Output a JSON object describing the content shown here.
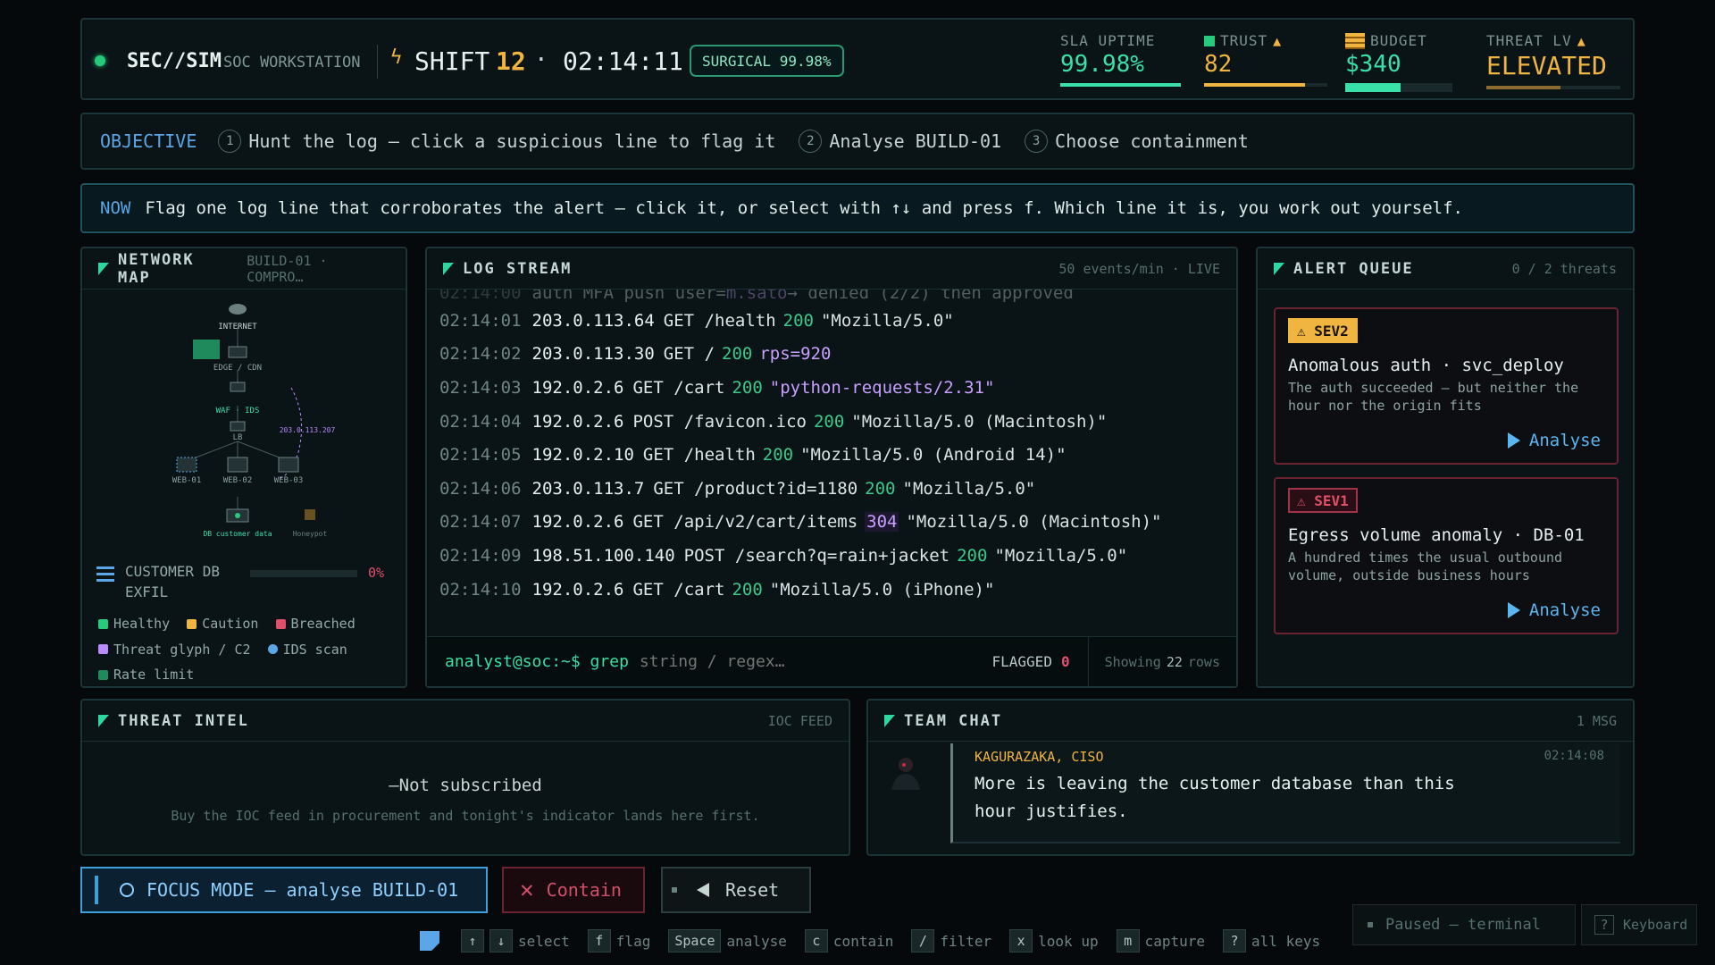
{
  "topbar": {
    "brand": "SEC//SIM",
    "brand_sub": "SOC WORKSTATION",
    "shift_icon": "lightning-icon",
    "shift_label": "SHIFT",
    "shift_num": "12",
    "clock": "02:14:11",
    "surgical": "SURGICAL 99.98%",
    "sla": {
      "label": "SLA UPTIME",
      "value": "99.98%",
      "level": 0.998
    },
    "trust": {
      "label": "TRUST",
      "value": "82",
      "level": 0.82
    },
    "budget": {
      "label": "BUDGET",
      "value": "$340",
      "level": 0.52
    },
    "threat": {
      "label": "THREAT LV",
      "value": "ELEVATED",
      "level": 0.55
    }
  },
  "objective": {
    "label": "OBJECTIVE",
    "steps": [
      {
        "num": "1",
        "text": "Hunt the log — click a suspicious line to flag it"
      },
      {
        "num": "2",
        "text": "Analyse BUILD-01"
      },
      {
        "num": "3",
        "text": "Choose containment"
      }
    ]
  },
  "now": {
    "label": "NOW",
    "text": "Flag one log line that corroborates the alert — click it, or select with ↑↓ and press f. Which line it is, you work out yourself."
  },
  "netmap": {
    "title": "NETWORK MAP",
    "sub": "BUILD-01 · COMPRO…",
    "nodes": {
      "internet": "INTERNET",
      "edge": "EDGE / CDN",
      "waf": "WAF · IDS",
      "lb": "LB",
      "web1": "WEB-01",
      "web2": "WEB-02",
      "web3": "WEB-03",
      "db": "DB customer data",
      "honeypot": "Honeypot",
      "threat_ip": "203.0.113.207"
    },
    "customer_db": {
      "label": "CUSTOMER DB EXFIL",
      "pct": "0%"
    },
    "legend": [
      {
        "label": "Healthy",
        "color": "#27c97d"
      },
      {
        "label": "Caution",
        "color": "#f0b440"
      },
      {
        "label": "Breached",
        "color": "#e0506a"
      },
      {
        "label": "Threat glyph / C2",
        "color": "#b88cff"
      },
      {
        "label": "IDS scan",
        "color": "#5aa6e6"
      },
      {
        "label": "Rate limit",
        "color": "#27c97d"
      }
    ]
  },
  "logstream": {
    "title": "LOG STREAM",
    "right": "50 events/min · LIVE",
    "faded": {
      "ts": "02:14:00",
      "pre": "auth MFA push user=",
      "user": "m.sato",
      "post": " → denied (2/2) then approved"
    },
    "lines": [
      {
        "ts": "02:14:01",
        "ip": "203.0.113.64",
        "method": "GET",
        "path": "/health",
        "status": "200",
        "ua": "\"Mozilla/5.0\""
      },
      {
        "ts": "02:14:02",
        "ip": "203.0.113.30",
        "method": "GET",
        "path": "/",
        "status": "200",
        "extra": "rps=920"
      },
      {
        "ts": "02:14:03",
        "ip": "192.0.2.6",
        "method": "GET",
        "path": "/cart",
        "status": "200",
        "ua_sus": "\"python-requests/2.31\""
      },
      {
        "ts": "02:14:04",
        "ip": "192.0.2.6",
        "method": "POST",
        "path": "/favicon.ico",
        "status": "200",
        "ua": "\"Mozilla/5.0 (Macintosh)\""
      },
      {
        "ts": "02:14:05",
        "ip": "192.0.2.10",
        "method": "GET",
        "path": "/health",
        "status": "200",
        "ua": "\"Mozilla/5.0 (Android 14)\""
      },
      {
        "ts": "02:14:06",
        "ip": "203.0.113.7",
        "method": "GET",
        "path": "/product?id=1180",
        "status": "200",
        "ua": "\"Mozilla/5.0\""
      },
      {
        "ts": "02:14:07",
        "ip": "192.0.2.6",
        "method": "GET",
        "path": "/api/v2/cart/items",
        "status": "304",
        "ua": "\"Mozilla/5.0 (Macintosh)\""
      },
      {
        "ts": "02:14:09",
        "ip": "198.51.100.140",
        "method": "POST",
        "path": "/search?q=rain+jacket",
        "status": "200",
        "ua": "\"Mozilla/5.0\""
      },
      {
        "ts": "02:14:10",
        "ip": "192.0.2.6",
        "method": "GET",
        "path": "/cart",
        "status": "200",
        "ua": "\"Mozilla/5.0 (iPhone)\""
      }
    ],
    "prompt": "analyst@soc:~$ grep",
    "placeholder": "string / regex…",
    "flagged_label": "FLAGGED",
    "flagged_count": "0",
    "showing_pre": "Showing",
    "showing_count": "22",
    "showing_post": "rows"
  },
  "alerts": {
    "title": "ALERT QUEUE",
    "right": "0 / 2 threats",
    "items": [
      {
        "sev": "SEV2",
        "title": "Anomalous auth · svc_deploy",
        "desc": "The auth succeeded — but neither the hour nor the origin fits",
        "action": "Analyse"
      },
      {
        "sev": "SEV1",
        "title": "Egress volume anomaly · DB-01",
        "desc": "A hundred times the usual outbound volume, outside business hours",
        "action": "Analyse"
      }
    ]
  },
  "intel": {
    "title": "THREAT INTEL",
    "right": "IOC FEED",
    "status": "—Not subscribed",
    "hint": "Buy the IOC feed in procurement and tonight's indicator lands here first."
  },
  "chat": {
    "title": "TEAM CHAT",
    "right": "1 MSG",
    "who": "KAGURAZAKA, CISO",
    "time": "02:14:08",
    "message": "More is leaving the customer database than this hour justifies."
  },
  "buttons": {
    "focus": "FOCUS MODE — analyse BUILD-01",
    "contain": "Contain",
    "reset": "Reset"
  },
  "hints": [
    {
      "keys": [
        "↑",
        "↓"
      ],
      "label": "select"
    },
    {
      "keys": [
        "f"
      ],
      "label": "flag"
    },
    {
      "keys": [
        "Space"
      ],
      "label": "analyse"
    },
    {
      "keys": [
        "c"
      ],
      "label": "contain"
    },
    {
      "keys": [
        "/"
      ],
      "label": "filter"
    },
    {
      "keys": [
        "x"
      ],
      "label": "look up"
    },
    {
      "keys": [
        "m"
      ],
      "label": "capture"
    },
    {
      "keys": [
        "?"
      ],
      "label": "all keys"
    }
  ],
  "paused": "Paused — terminal",
  "keyboard": {
    "key": "?",
    "label": "Keyboard"
  }
}
